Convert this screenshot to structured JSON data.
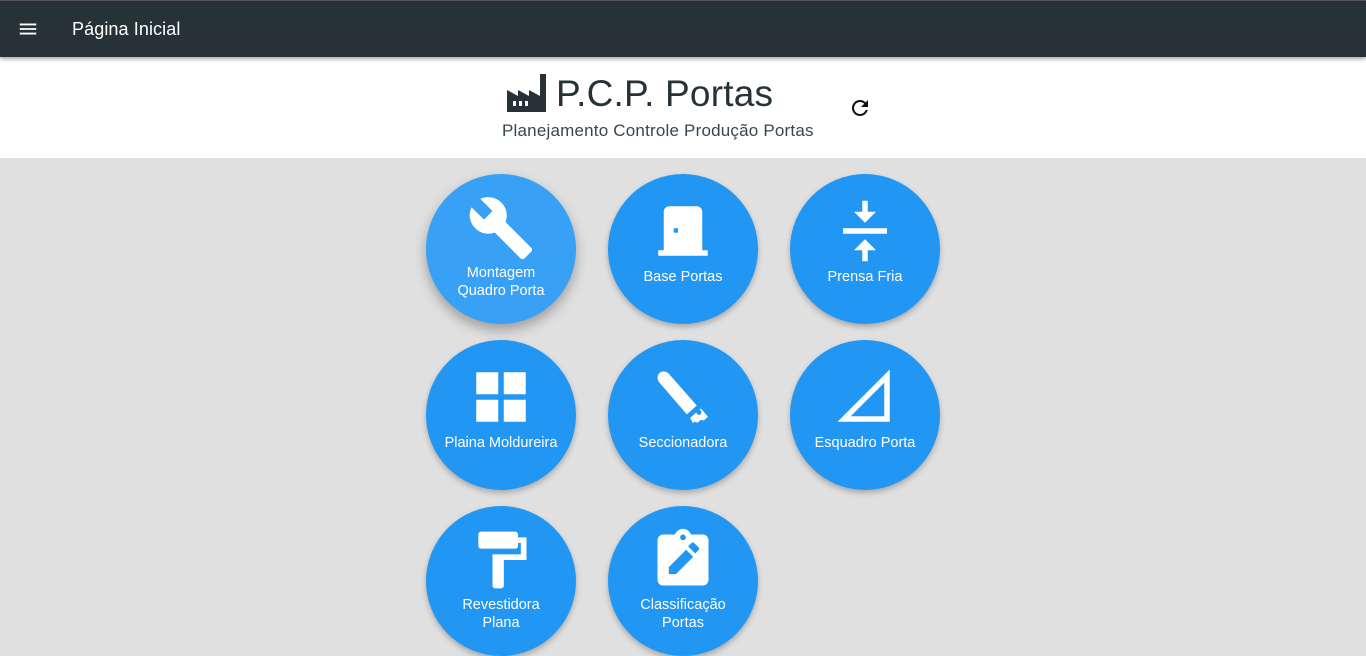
{
  "topbar": {
    "title": "Página Inicial",
    "menu_icon": "menu-icon"
  },
  "header": {
    "title": "P.C.P. Portas",
    "subtitle": "Planejamento Controle Produção Portas",
    "logo_icon": "factory-icon",
    "refresh_icon": "refresh-icon"
  },
  "colors": {
    "topbar": "#263238",
    "tile": "#2196f3",
    "tile_hover": "#38a0f5",
    "background": "#e0e0e0"
  },
  "tiles": [
    {
      "label": "Montagem\nQuadro Porta",
      "icon": "wrench-icon"
    },
    {
      "label": "Base Portas",
      "icon": "door-icon"
    },
    {
      "label": "Prensa Fria",
      "icon": "vertical-align-center-icon"
    },
    {
      "label": "Plaina Moldureira",
      "icon": "grid-icon"
    },
    {
      "label": "Seccionadora",
      "icon": "saw-icon"
    },
    {
      "label": "Esquadro Porta",
      "icon": "set-square-icon"
    },
    {
      "label": "Revestidora\nPlana",
      "icon": "paint-roller-icon"
    },
    {
      "label": "Classificação\nPortas",
      "icon": "clipboard-edit-icon"
    }
  ]
}
